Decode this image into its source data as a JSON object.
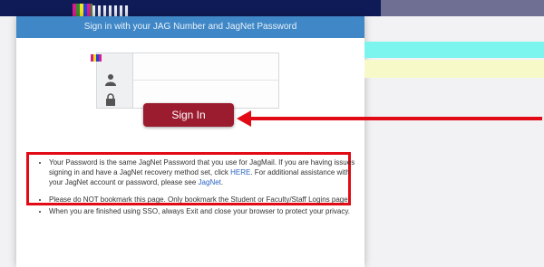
{
  "header": {
    "title": "Sign in with your JAG Number and JagNet Password"
  },
  "form": {
    "username_value": "",
    "password_value": "",
    "sign_in_label": "Sign In"
  },
  "notes": {
    "n1_before": "Your Password is the same JagNet Password that you use for JagMail. If you are having issues signing in and have a JagNet recovery method set, click ",
    "n1_link": "HERE",
    "n1_mid": ". For additional assistance with your JagNet account or password, please see ",
    "n1_link2": "JagNet",
    "n1_after": ".",
    "n2": "Please do NOT bookmark this page. Only bookmark the Student or Faculty/Staff Logins page.",
    "n3": "When you are finished using SSO, always Exit and close your browser to protect your privacy."
  },
  "colors": {
    "header_blue": "#3f87c6",
    "button_red": "#9b1b2f",
    "annotation_red": "#e20b15",
    "link_blue": "#2a63c6"
  },
  "icons": [
    "user-icon",
    "lock-icon",
    "arrow-left-icon"
  ]
}
